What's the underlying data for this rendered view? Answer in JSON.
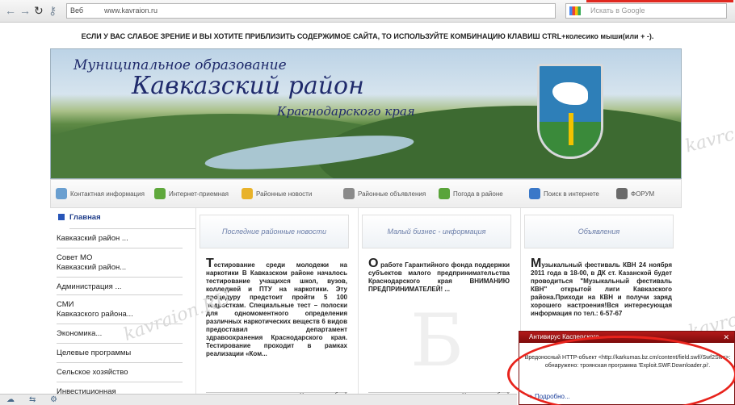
{
  "browser": {
    "nav_back": "←",
    "nav_forward": "→",
    "reload": "↻",
    "key_icon": "⚷",
    "site_label": "Веб",
    "url": "www.kavraion.ru",
    "search_placeholder": "Искать в Google"
  },
  "notice": "ЕСЛИ У ВАС СЛАБОЕ ЗРЕНИЕ И ВЫ ХОТИТЕ ПРИБЛИЗИТЬ СОДЕРЖИМОЕ САЙТА, ТО ИСПОЛЬЗУЙТЕ КОМБИНАЦИЮ КЛАВИШ CTRL+колесико мыши(или + -).",
  "banner": {
    "line1": "Муниципальное образование",
    "line2": "Кавказский район",
    "line3": "Краснодарского края"
  },
  "navbar": [
    {
      "label": "Контактная информация",
      "color": "#6a9fd0"
    },
    {
      "label": "Интернет-приемная",
      "color": "#5fa83c"
    },
    {
      "label": "Районные новости",
      "color": "#e8b22a"
    },
    {
      "label": "Районные объявления",
      "color": "#8a8a8a"
    },
    {
      "label": "Погода в районе",
      "color": "#5aa43a"
    },
    {
      "label": "Поиск в интернете",
      "color": "#3a78c8"
    },
    {
      "label": "ФОРУМ",
      "color": "#6a6a6a"
    }
  ],
  "sidebar": [
    {
      "label": "Главная"
    },
    {
      "label": "Кавказский район ..."
    },
    {
      "label": "Совет МО\nКавказский район..."
    },
    {
      "label": "Администрация ..."
    },
    {
      "label": "СМИ\nКавказского района..."
    },
    {
      "label": "Экономика..."
    },
    {
      "label": "Целевые программы"
    },
    {
      "label": "Сельское хозяйство"
    },
    {
      "label": "Инвестиционная"
    }
  ],
  "columns": [
    {
      "header": "Последние районные новости",
      "dropcap": "Т",
      "text": "естирование среди молодежи на наркотики В Кавказском районе началось тестирование учащихся школ, вузов, колледжей и ПТУ на наркотики. Эту процедуру предстоит пройти 5 100 подросткам. Специальные тест – полоски для одномоментного определения различных наркотических веществ 6 видов предоставил департамент здравоохранения Краснодарского края. Тестирование проходит в рамках реализации «Ком...",
      "more": "Узнать подробней"
    },
    {
      "header": "Малый бизнес - информация",
      "dropcap": "О",
      "text": " работе Гарантийного фонда поддержки субъектов малого предпринимательства Краснодарского края ВНИМАНИЮ ПРЕДПРИНИМАТЕЛЕЙ! ...",
      "more": "Узнать подробней"
    },
    {
      "header": "Объявления",
      "dropcap": "М",
      "text": "узыкальный фестиваль КВН 24 ноября 2011 года в 18-00, в ДК ст. Казанской будет проводиться \"Музыкальный фестиваль КВН\" открытой лиги Кавказского района.Приходи на КВН и получи заряд хорошего настроения!Вся интересующая информация по тел.: 6-57-67",
      "more": ""
    }
  ],
  "watermarks": [
    "kavraion.RU",
    "kavrc",
    "kavrc"
  ],
  "big_letter": "Б",
  "popup": {
    "title": "Антивирус Касперского",
    "close": "✕",
    "body": "Вредоносный HTTP-объект <http://karkumas.bz.cm/content/field.swf//Swf2Swc>: обнаружено: троянская программа 'Exploit.SWF.Downloader.pi'.",
    "link": "Подробно..."
  },
  "colors": {
    "accent": "#e8231c",
    "popup_header": "#9e1414",
    "link": "#1a3e9a"
  }
}
